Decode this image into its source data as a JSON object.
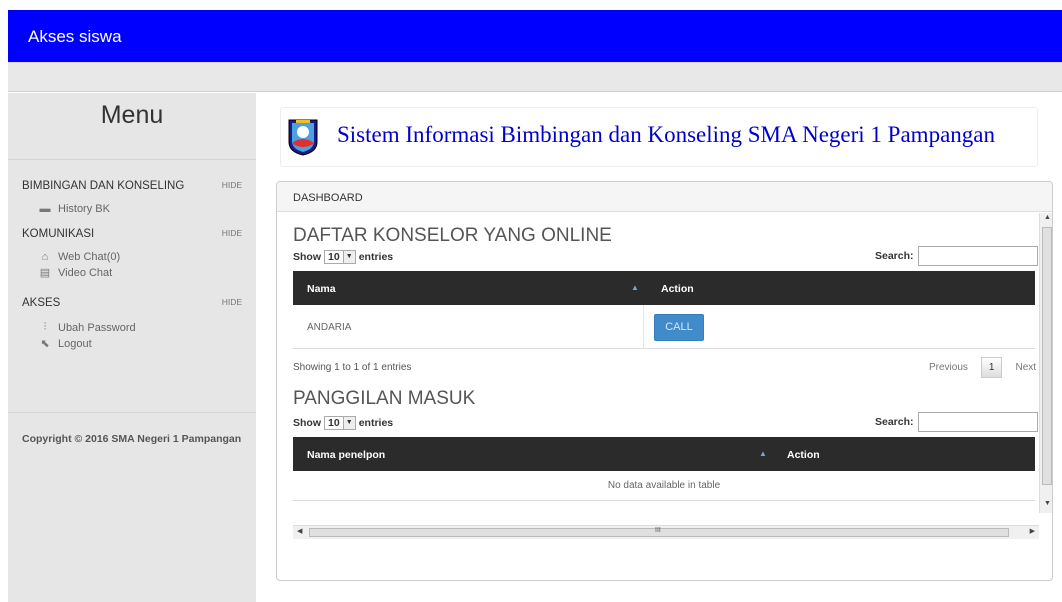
{
  "app": {
    "title": "Akses siswa"
  },
  "sidebar": {
    "menu_title": "Menu",
    "sections": [
      {
        "label": "BIMBINGAN DAN KONSELING",
        "hide": "HIDE",
        "items": [
          {
            "label": "History BK",
            "icon": "folder-icon"
          }
        ]
      },
      {
        "label": "KOMUNIKASI",
        "hide": "HIDE",
        "items": [
          {
            "label": "Web Chat(0)",
            "icon": "chat-icon"
          },
          {
            "label": "Video Chat",
            "icon": "film-icon"
          }
        ]
      },
      {
        "label": "AKSES",
        "hide": "HIDE",
        "items": [
          {
            "label": "Ubah Password",
            "icon": "sliders-icon"
          },
          {
            "label": "Logout",
            "icon": "logout-icon"
          }
        ]
      }
    ],
    "copyright": "Copyright © 2016 SMA Negeri 1 Pampangan"
  },
  "banner": {
    "title": "Sistem Informasi Bimbingan dan Konseling SMA Negeri 1 Pampangan"
  },
  "panel": {
    "heading": "DASHBOARD"
  },
  "konselor": {
    "title": "DAFTAR KONSELOR YANG ONLINE",
    "show": "Show",
    "entries_value": "10",
    "entries": "entries",
    "search_label": "Search:",
    "columns": [
      "Nama",
      "Action"
    ],
    "rows": [
      {
        "nama": "ANDARIA",
        "action": "CALL"
      }
    ],
    "info": "Showing 1 to 1 of 1 entries",
    "pager": {
      "previous": "Previous",
      "current": "1",
      "next": "Next"
    }
  },
  "panggilan": {
    "title": "PANGGILAN MASUK",
    "show": "Show",
    "entries_value": "10",
    "entries": "entries",
    "search_label": "Search:",
    "columns": [
      "Nama penelpon",
      "Action"
    ],
    "empty": "No data available in table"
  },
  "colors": {
    "topbar": "#0000ff",
    "banner_text": "#0000cc",
    "call_button": "#428bca",
    "table_header": "#2b2b2b"
  }
}
